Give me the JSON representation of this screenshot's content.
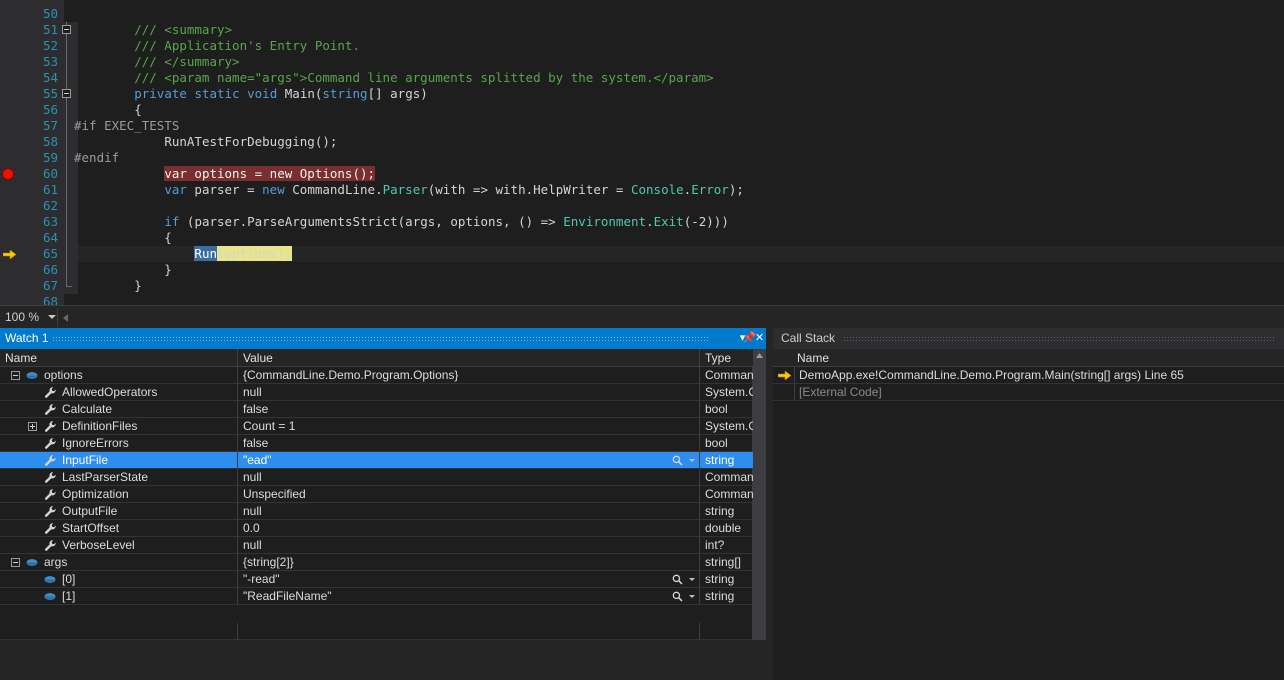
{
  "editor": {
    "zoom_level": "100 %",
    "first_line_number": 50,
    "breakpoint_line": 60,
    "current_statement_line": 65,
    "lines": [
      {
        "num": "",
        "text": "",
        "partial_top": true
      },
      {
        "num": "50",
        "text": ""
      },
      {
        "num": "51",
        "text": "        /// <summary>",
        "fold": "start"
      },
      {
        "num": "52",
        "text": "        /// Application's Entry Point."
      },
      {
        "num": "53",
        "text": "        /// </summary>"
      },
      {
        "num": "54",
        "text": "        /// <param name=\"args\">Command line arguments splitted by the system.</param>"
      },
      {
        "num": "55",
        "text": "        private static void Main(string[] args)",
        "fold": "start"
      },
      {
        "num": "56",
        "text": "        {"
      },
      {
        "num": "57",
        "text": "#if EXEC_TESTS"
      },
      {
        "num": "58",
        "text": "            RunATestForDebugging();"
      },
      {
        "num": "59",
        "text": "#endif"
      },
      {
        "num": "60",
        "text": "            var options = new Options();"
      },
      {
        "num": "61",
        "text": "            var parser = new CommandLine.Parser(with => with.HelpWriter = Console.Error);"
      },
      {
        "num": "62",
        "text": ""
      },
      {
        "num": "63",
        "text": "            if (parser.ParseArgumentsStrict(args, options, () => Environment.Exit(-2)))"
      },
      {
        "num": "64",
        "text": "            {"
      },
      {
        "num": "65",
        "text": "                Run(options);"
      },
      {
        "num": "66",
        "text": "            }"
      },
      {
        "num": "67",
        "text": "        }"
      },
      {
        "num": "68",
        "text": ""
      }
    ]
  },
  "watch_panel": {
    "title": "Watch 1",
    "active": true,
    "title_buttons": [
      "chevron-down-icon",
      "pin-icon",
      "close-icon"
    ],
    "columns": [
      "Name",
      "Value",
      "Type"
    ],
    "rows": [
      {
        "name": "options",
        "value": "{CommandLine.Demo.Program.Options}",
        "type": "Comman",
        "indent": 0,
        "expander": "minus",
        "icon": "field-icon",
        "selected": false,
        "magnifier": false
      },
      {
        "name": "AllowedOperators",
        "value": "null",
        "type": "System.C",
        "indent": 1,
        "expander": "none",
        "icon": "wrench-icon",
        "selected": false,
        "magnifier": false
      },
      {
        "name": "Calculate",
        "value": "false",
        "type": "bool",
        "indent": 1,
        "expander": "none",
        "icon": "wrench-icon",
        "selected": false,
        "magnifier": false
      },
      {
        "name": "DefinitionFiles",
        "value": "Count = 1",
        "type": "System.C",
        "indent": 1,
        "expander": "plus",
        "icon": "wrench-icon",
        "selected": false,
        "magnifier": false
      },
      {
        "name": "IgnoreErrors",
        "value": "false",
        "type": "bool",
        "indent": 1,
        "expander": "none",
        "icon": "wrench-icon",
        "selected": false,
        "magnifier": false
      },
      {
        "name": "InputFile",
        "value": "\"ead\"",
        "type": "string",
        "indent": 1,
        "expander": "none",
        "icon": "wrench-icon",
        "selected": true,
        "magnifier": true
      },
      {
        "name": "LastParserState",
        "value": "null",
        "type": "Comman",
        "indent": 1,
        "expander": "none",
        "icon": "wrench-icon",
        "selected": false,
        "magnifier": false
      },
      {
        "name": "Optimization",
        "value": "Unspecified",
        "type": "Comman",
        "indent": 1,
        "expander": "none",
        "icon": "wrench-icon",
        "selected": false,
        "magnifier": false
      },
      {
        "name": "OutputFile",
        "value": "null",
        "type": "string",
        "indent": 1,
        "expander": "none",
        "icon": "wrench-icon",
        "selected": false,
        "magnifier": false
      },
      {
        "name": "StartOffset",
        "value": "0.0",
        "type": "double",
        "indent": 1,
        "expander": "none",
        "icon": "wrench-icon",
        "selected": false,
        "magnifier": false
      },
      {
        "name": "VerboseLevel",
        "value": "null",
        "type": "int?",
        "indent": 1,
        "expander": "none",
        "icon": "wrench-icon",
        "selected": false,
        "magnifier": false
      },
      {
        "name": "args",
        "value": "{string[2]}",
        "type": "string[]",
        "indent": 0,
        "expander": "minus",
        "icon": "field-icon",
        "selected": false,
        "magnifier": false
      },
      {
        "name": "[0]",
        "value": "\"-read\"",
        "type": "string",
        "indent": 1,
        "expander": "none",
        "icon": "field-icon",
        "selected": false,
        "magnifier": true
      },
      {
        "name": "[1]",
        "value": "\"ReadFileName\"",
        "type": "string",
        "indent": 1,
        "expander": "none",
        "icon": "field-icon",
        "selected": false,
        "magnifier": true
      }
    ]
  },
  "call_stack_panel": {
    "title": "Call Stack",
    "active": false,
    "columns": [
      "Name"
    ],
    "rows": [
      {
        "name": "DemoApp.exe!CommandLine.Demo.Program.Main(string[] args) Line 65",
        "current": true,
        "external": false
      },
      {
        "name": "[External Code]",
        "current": false,
        "external": true
      }
    ]
  },
  "colors": {
    "editor_bg": "#1e1e1e",
    "gutter_bg": "#2d2d30",
    "line_number": "#2b91af",
    "keyword": "#569cd6",
    "comment": "#57a64a",
    "type": "#4ec9b0",
    "string": "#d69d85",
    "number": "#b5cea8",
    "breakpoint": "#e51400",
    "breakpoint_line_bg": "#7a2e2e",
    "current_statement_bg": "#e9e58a",
    "selection_bg": "#3b6e9e",
    "active_panel_title": "#007acc",
    "selected_row": "#2d8ef0",
    "current_arrow": "#ffc800"
  }
}
